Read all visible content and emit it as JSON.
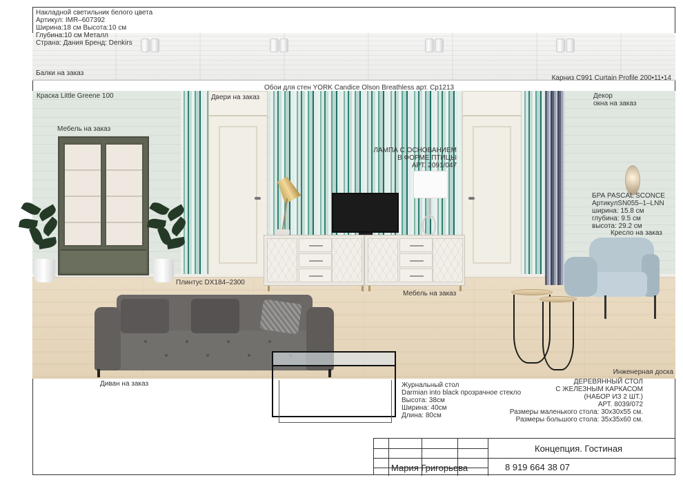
{
  "fixture_spec": {
    "lines": [
      "Накладной светильник белого цвета",
      "Артикул: IMR–607392",
      "Ширина:18 см Высота:10 см",
      "Глубина:10 см Металл",
      "Страна: Дания Бренд: Denkirs"
    ]
  },
  "labels": {
    "beams": "Балки на заказ",
    "cornice": "Карниз C991 Curtain Profile 200•11•14",
    "wallpaper": "Обои для стен YORK Candice Olson Breathless арт. Cp1213",
    "paint": "Краска Little Greene 100",
    "doors": "Двери на заказ",
    "window_decor": [
      "Декор",
      "окна на заказ"
    ],
    "furniture_left": "Мебель на заказ",
    "lamp": [
      "ЛАМПА С ОСНОВАНИЕМ",
      "В ФОРМЕ ПТИЦЫ",
      "АРТ. 2091/047"
    ],
    "sconce": [
      "БРА PASCAL SCONCE",
      "АртикулSN055–1–LNN",
      "ширина: 15.8 см",
      "глубина: 9.5 см",
      "высота: 29.2 см"
    ],
    "armchair": "Кресло на заказ",
    "plinth": "Плинтус DX184–2300",
    "furniture_center": "Мебель на заказ",
    "flooring": "Инженерная доска",
    "sofa": "Диван на заказ"
  },
  "coffee_table_spec": {
    "lines": [
      "Журнальный стол",
      "Darmian into black прозрачное стекло",
      "Высота: 38см",
      "Ширина: 40см",
      "Длина: 80см"
    ]
  },
  "side_table_spec": {
    "lines": [
      "ДЕРЕВЯННЫЙ СТОЛ",
      "С ЖЕЛЕЗНЫМ КАРКАСОМ",
      "(НАБОР ИЗ 2 ШТ.)",
      "АРТ. 8039/072",
      "Размеры маленького стола: 30x30x55 см.",
      "Размеры большого стола: 35x35x60 см."
    ]
  },
  "title_block": {
    "project": "Концепция. Гостиная",
    "author": "Мария Григорьева",
    "phone": "8 919 664 38 07"
  },
  "colors": {
    "wall": "#dfe7e0",
    "wallpaper_teal": "#2f7f74",
    "sofa": "#6b6866",
    "armchair": "#b7c8d1",
    "cabinet": "#5f6454"
  }
}
